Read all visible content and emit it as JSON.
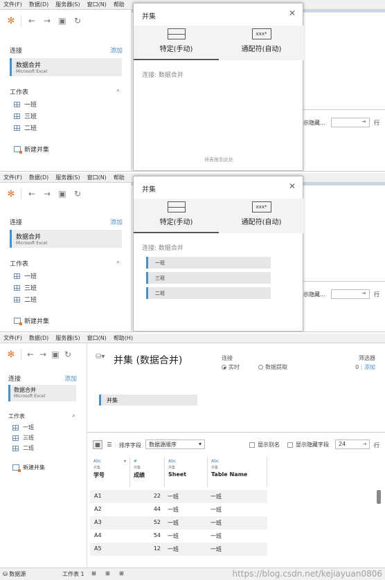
{
  "menu": [
    "文件(F)",
    "数据(D)",
    "服务器(S)",
    "窗口(N)",
    "帮助(H)"
  ],
  "menu_trunc": "帮助",
  "sidebar": {
    "connections_label": "连接",
    "add_label": "添加",
    "connection_name": "数据合并",
    "connection_type": "Microsoft Excel",
    "sheets_label": "工作表",
    "sheets": [
      "一班",
      "三班",
      "二班"
    ],
    "new_union": "新建并集"
  },
  "union_dialog": {
    "title": "并集",
    "tab_manual": "特定(手动)",
    "tab_wildcard": "通配符(自动)",
    "wildcard_icon_text": "xxx*",
    "connection_text": "连接: 数据合并",
    "drop_hint": "将表拖到此处",
    "items_added": [
      "一班",
      "三班",
      "二班"
    ]
  },
  "background_snippets": {
    "show_hidden": "示隐藏...",
    "rows_label": "行"
  },
  "datasource": {
    "title": "并集 (数据合并)",
    "connection_label": "连接",
    "live": "实时",
    "extract": "数据提取",
    "filters_label": "筛选器",
    "filters_count": "0",
    "filters_add": "添加",
    "canvas_table": "并集",
    "sort_label": "排序字段",
    "sort_value": "数据源顺序",
    "show_alias": "显示别名",
    "show_hidden": "显示隐藏字段",
    "rows_value": "24",
    "rows_label": "行",
    "columns": [
      {
        "type": "Abc",
        "source": "并集",
        "name": "学号"
      },
      {
        "type": "#",
        "source": "并集",
        "name": "成绩"
      },
      {
        "type": "Abc",
        "source": "并集",
        "name": "Sheet"
      },
      {
        "type": "Abc",
        "source": "并集",
        "name": "Table Name"
      }
    ],
    "rows": [
      [
        "A1",
        "22",
        "一班",
        "一班"
      ],
      [
        "A2",
        "44",
        "一班",
        "一班"
      ],
      [
        "A3",
        "52",
        "一班",
        "一班"
      ],
      [
        "A4",
        "54",
        "一班",
        "一班"
      ],
      [
        "A5",
        "12",
        "一班",
        "一班"
      ]
    ]
  },
  "bottom_tabs": {
    "datasource": "数据源",
    "sheet1": "工作表 1"
  },
  "watermark": "https://blog.csdn.net/kejiayuan0806"
}
